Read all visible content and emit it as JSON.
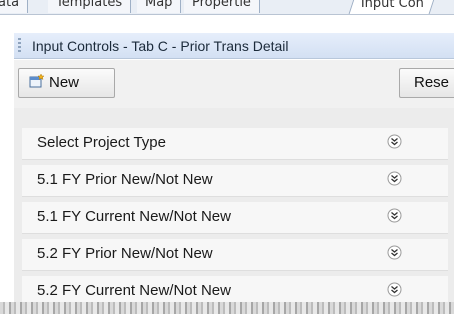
{
  "tabs": [
    {
      "label": "Data"
    },
    {
      "label": "Templates"
    },
    {
      "label": "Map"
    },
    {
      "label": "Propertie"
    },
    {
      "label": "Input Con"
    }
  ],
  "panel_title": "Input Controls - Tab C - Prior Trans Detail",
  "toolbar": {
    "new_label": "New",
    "reset_label": "Rese"
  },
  "rows": [
    {
      "label": "Select Project Type"
    },
    {
      "label": "5.1 FY Prior New/Not New"
    },
    {
      "label": "5.1 FY Current New/Not New"
    },
    {
      "label": "5.2 FY Prior New/Not New"
    },
    {
      "label": "5.2 FY Current New/Not New"
    }
  ],
  "icons": {
    "new": "new-document-icon",
    "row_toggle": "double-chevron-down-icon"
  },
  "colors": {
    "title_bar": "#dbe6f6",
    "panel_bg": "#ececec",
    "row_bg": "#f7f7f7"
  }
}
